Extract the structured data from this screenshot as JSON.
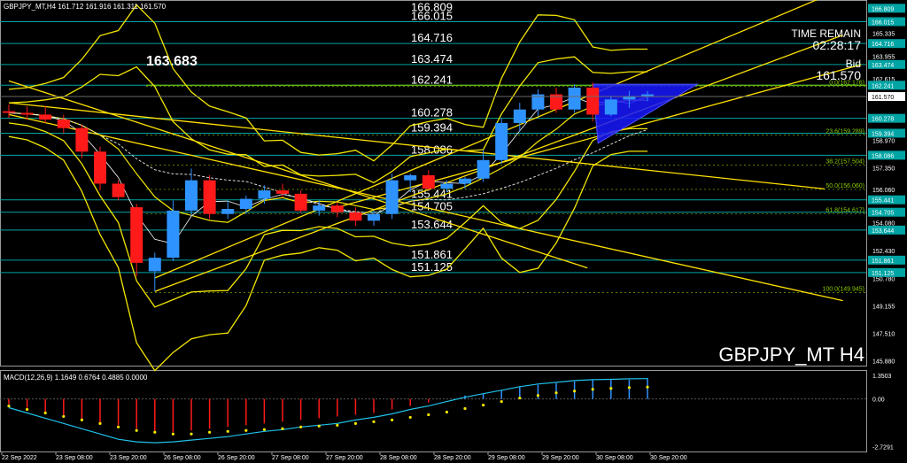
{
  "header": {
    "instrument_line": "GBPJPY_MT,H4  161.712 161.916 161.311 161.570"
  },
  "timer": {
    "label": "TIME REMAIN",
    "value": "02:28:17",
    "bid_label": "Bid",
    "bid_value": "161.570"
  },
  "watermark": "GBPJPY_MT H4",
  "colors": {
    "bull": "#2f93ff",
    "bear": "#ff1a1a",
    "level_line": "#00a4a4",
    "bands": "#f2e600",
    "ma": "#ffe100",
    "fib": "#8ccc00",
    "macd_hist": "#2f93ff",
    "macd_signal": "#f2e600",
    "macd_line": "#20c0e8",
    "triangle": "#1818ff"
  },
  "chart_data": [
    {
      "type": "candlestick",
      "title": "GBPJPY_MT,H4",
      "x_labels": [
        "22 Sep 2022",
        "23 Sep 08:00",
        "23 Sep 20:00",
        "26 Sep 08:00",
        "26 Sep 20:00",
        "27 Sep 08:00",
        "27 Sep 20:00",
        "28 Sep 08:00",
        "28 Sep 20:00",
        "29 Sep 08:00",
        "29 Sep 20:00",
        "30 Sep 08:00",
        "30 Sep 20:00"
      ],
      "y_ticks": [
        "166.809",
        "166.015",
        "165.335",
        "164.716",
        "163.955",
        "163.474",
        "162.615",
        "162.241",
        "161.570",
        "160.278",
        "159.394",
        "158.970",
        "158.086",
        "157.350",
        "156.060",
        "155.441",
        "154.705",
        "154.080",
        "153.644",
        "152.430",
        "151.861",
        "151.125",
        "150.780",
        "149.155",
        "147.510",
        "145.880"
      ],
      "ylim": [
        145.6,
        167.3
      ],
      "candles": [
        {
          "o": 160.7,
          "h": 161.1,
          "l": 160.3,
          "c": 160.6
        },
        {
          "o": 160.6,
          "h": 161.0,
          "l": 160.2,
          "c": 160.5
        },
        {
          "o": 160.5,
          "h": 161.0,
          "l": 160.0,
          "c": 160.2
        },
        {
          "o": 160.2,
          "h": 160.5,
          "l": 159.4,
          "c": 159.7
        },
        {
          "o": 159.7,
          "h": 159.9,
          "l": 157.9,
          "c": 158.3
        },
        {
          "o": 158.3,
          "h": 158.6,
          "l": 156.0,
          "c": 156.4
        },
        {
          "o": 156.4,
          "h": 156.6,
          "l": 155.4,
          "c": 155.6
        },
        {
          "o": 155.0,
          "h": 155.2,
          "l": 150.9,
          "c": 151.7
        },
        {
          "o": 151.2,
          "h": 152.3,
          "l": 150.0,
          "c": 152.0
        },
        {
          "o": 152.0,
          "h": 155.4,
          "l": 151.8,
          "c": 154.8
        },
        {
          "o": 154.8,
          "h": 157.3,
          "l": 154.5,
          "c": 156.6
        },
        {
          "o": 156.6,
          "h": 156.9,
          "l": 154.3,
          "c": 154.6
        },
        {
          "o": 154.6,
          "h": 155.4,
          "l": 154.3,
          "c": 154.9
        },
        {
          "o": 154.9,
          "h": 155.7,
          "l": 154.6,
          "c": 155.5
        },
        {
          "o": 155.5,
          "h": 156.3,
          "l": 155.2,
          "c": 156.0
        },
        {
          "o": 156.0,
          "h": 156.4,
          "l": 155.6,
          "c": 155.8
        },
        {
          "o": 155.8,
          "h": 156.0,
          "l": 154.7,
          "c": 154.8
        },
        {
          "o": 154.8,
          "h": 155.4,
          "l": 154.5,
          "c": 155.1
        },
        {
          "o": 155.1,
          "h": 155.3,
          "l": 154.4,
          "c": 154.7
        },
        {
          "o": 154.7,
          "h": 155.0,
          "l": 153.9,
          "c": 154.2
        },
        {
          "o": 154.2,
          "h": 154.8,
          "l": 153.9,
          "c": 154.6
        },
        {
          "o": 154.6,
          "h": 157.0,
          "l": 154.3,
          "c": 156.6
        },
        {
          "o": 156.6,
          "h": 157.0,
          "l": 155.9,
          "c": 156.9
        },
        {
          "o": 156.9,
          "h": 157.2,
          "l": 156.0,
          "c": 156.1
        },
        {
          "o": 156.1,
          "h": 156.6,
          "l": 155.9,
          "c": 156.4
        },
        {
          "o": 156.4,
          "h": 156.8,
          "l": 156.1,
          "c": 156.7
        },
        {
          "o": 156.7,
          "h": 158.4,
          "l": 156.5,
          "c": 157.8
        },
        {
          "o": 157.8,
          "h": 160.3,
          "l": 157.6,
          "c": 160.0
        },
        {
          "o": 160.0,
          "h": 161.2,
          "l": 159.5,
          "c": 160.8
        },
        {
          "o": 160.8,
          "h": 162.0,
          "l": 160.4,
          "c": 161.7
        },
        {
          "o": 161.7,
          "h": 162.1,
          "l": 160.6,
          "c": 160.8
        },
        {
          "o": 160.8,
          "h": 162.3,
          "l": 160.6,
          "c": 162.1
        },
        {
          "o": 162.1,
          "h": 162.4,
          "l": 160.1,
          "c": 160.5
        },
        {
          "o": 160.5,
          "h": 161.6,
          "l": 160.4,
          "c": 161.4
        },
        {
          "o": 161.4,
          "h": 161.9,
          "l": 160.9,
          "c": 161.6
        },
        {
          "o": 161.6,
          "h": 161.9,
          "l": 161.3,
          "c": 161.7
        }
      ],
      "levels": [
        {
          "value": 166.015,
          "label": "166.015"
        },
        {
          "value": 164.716,
          "label": "164.716"
        },
        {
          "value": 163.474,
          "label": "163.474"
        },
        {
          "value": 162.241,
          "label": "162.241"
        },
        {
          "value": 160.278,
          "label": "160.278"
        },
        {
          "value": 159.394,
          "label": "159.394"
        },
        {
          "value": 158.086,
          "label": "158.086"
        },
        {
          "value": 155.441,
          "label": "155.441"
        },
        {
          "value": 154.705,
          "label": "154.705"
        },
        {
          "value": 153.644,
          "label": "153.644"
        },
        {
          "value": 151.861,
          "label": "151.861"
        },
        {
          "value": 151.125,
          "label": "151.125"
        }
      ],
      "top_partial_label": "166.809",
      "big_label": {
        "value": 163.683,
        "text": "163.683"
      },
      "price_tags": [
        {
          "value": 166.809,
          "text": "166.809"
        },
        {
          "value": 166.015,
          "text": "166.015"
        },
        {
          "value": 164.716,
          "text": "164.716"
        },
        {
          "value": 163.474,
          "text": "163.474"
        },
        {
          "value": 162.241,
          "text": "162.241"
        },
        {
          "value": 160.278,
          "text": "160.278"
        },
        {
          "value": 159.394,
          "text": "159.394"
        },
        {
          "value": 158.086,
          "text": "158.086"
        },
        {
          "value": 155.441,
          "text": "155.441"
        },
        {
          "value": 154.705,
          "text": "154.705"
        },
        {
          "value": 153.644,
          "text": "153.644"
        },
        {
          "value": 151.861,
          "text": "151.861"
        },
        {
          "value": 151.125,
          "text": "151.125"
        }
      ],
      "current_price": {
        "value": 161.57,
        "text": "161.570"
      },
      "fib_labels": [
        {
          "value": 162.176,
          "text": "0.0(162.176)"
        },
        {
          "value": 159.289,
          "text": "23.6(159.289)"
        },
        {
          "value": 157.504,
          "text": "38.2(157.504)"
        },
        {
          "value": 156.06,
          "text": "50.0(156.060)"
        },
        {
          "value": 154.617,
          "text": "61.8(154.617)"
        },
        {
          "value": 149.945,
          "text": "100.0(149.945)"
        }
      ]
    },
    {
      "type": "histogram",
      "title": "MACD(12,26,9) 1.1649 0.6764 0.4885 0.0000",
      "y_ticks": [
        "1.3503",
        "0.00",
        "-2.7291"
      ],
      "ylim": [
        -3.0,
        1.6
      ],
      "histogram": [
        -0.3,
        -0.5,
        -0.8,
        -1.0,
        -1.2,
        -1.4,
        -1.5,
        -1.7,
        -1.9,
        -1.9,
        -1.8,
        -1.7,
        -1.6,
        -1.5,
        -1.4,
        -1.3,
        -1.2,
        -1.1,
        -1.0,
        -0.9,
        -0.8,
        -0.6,
        -0.4,
        -0.2,
        0.0,
        0.2,
        0.3,
        0.5,
        0.7,
        0.8,
        0.9,
        1.0,
        1.1,
        1.1,
        1.1,
        1.2
      ],
      "signal": [
        -0.4,
        -0.6,
        -0.8,
        -1.0,
        -1.2,
        -1.4,
        -1.6,
        -1.8,
        -1.9,
        -2.0,
        -2.0,
        -1.9,
        -1.85,
        -1.8,
        -1.75,
        -1.7,
        -1.6,
        -1.55,
        -1.5,
        -1.4,
        -1.3,
        -1.2,
        -1.05,
        -0.9,
        -0.75,
        -0.55,
        -0.35,
        -0.15,
        0.05,
        0.2,
        0.35,
        0.45,
        0.55,
        0.6,
        0.65,
        0.68
      ],
      "macd_line": [
        -0.5,
        -0.8,
        -1.1,
        -1.4,
        -1.7,
        -2.0,
        -2.3,
        -2.45,
        -2.5,
        -2.45,
        -2.35,
        -2.25,
        -2.15,
        -2.0,
        -1.85,
        -1.75,
        -1.6,
        -1.5,
        -1.4,
        -1.2,
        -1.05,
        -0.85,
        -0.6,
        -0.4,
        -0.15,
        0.1,
        0.3,
        0.5,
        0.7,
        0.85,
        0.95,
        1.05,
        1.1,
        1.12,
        1.15,
        1.16
      ]
    }
  ]
}
